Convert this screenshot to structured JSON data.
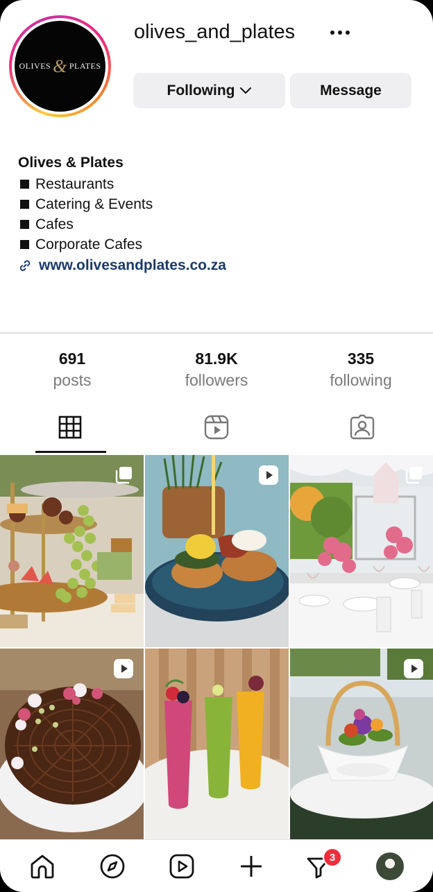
{
  "profile": {
    "username": "olives_and_plates",
    "avatar_text_left": "OLIVES",
    "avatar_amp": "&",
    "avatar_text_right": "PLATES",
    "following_label": "Following",
    "message_label": "Message"
  },
  "bio": {
    "name": "Olives & Plates",
    "lines": [
      "Restaurants",
      "Catering & Events",
      "Cafes",
      "Corporate Cafes"
    ],
    "link": "www.olivesandplates.co.za"
  },
  "stats": {
    "posts": {
      "value": "691",
      "label": "posts"
    },
    "followers": {
      "value": "81.9K",
      "label": "followers"
    },
    "following": {
      "value": "335",
      "label": "following"
    }
  },
  "tabs": [
    {
      "icon": "grid-icon",
      "selected": true
    },
    {
      "icon": "reels-icon",
      "selected": false
    },
    {
      "icon": "tagged-icon",
      "selected": false
    }
  ],
  "posts": [
    {
      "subject": "high tea stand",
      "badge": "carousel-icon"
    },
    {
      "subject": "eggs benedict",
      "badge": "reel-icon"
    },
    {
      "subject": "table setting with roses",
      "badge": "carousel-icon"
    },
    {
      "subject": "chocolate tart",
      "badge": "reel-icon"
    },
    {
      "subject": "three smoothies",
      "badge": "none"
    },
    {
      "subject": "basket dessert",
      "badge": "reel-icon"
    }
  ],
  "nav": {
    "items": [
      "home-icon",
      "explore-icon",
      "reels-icon",
      "create-icon",
      "activity-icon",
      "profile-avatar"
    ],
    "notification_count": "3"
  },
  "colors": {
    "accent_link": "#1a3a6b",
    "button_bg": "#efeff1",
    "badge_red": "#ee2d3d"
  }
}
